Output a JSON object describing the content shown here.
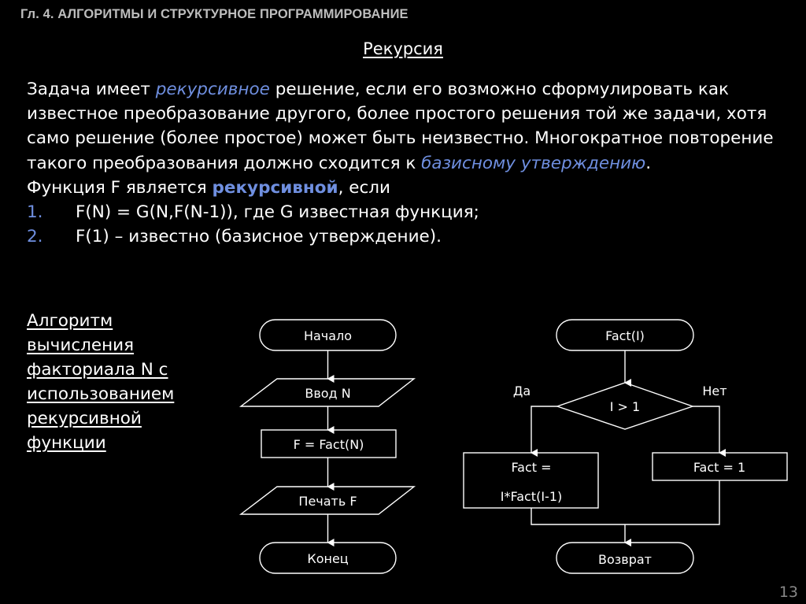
{
  "header": {
    "chapter": "Гл. 4. АЛГОРИТМЫ И СТРУКТУРНОЕ ПРОГРАММИРОВАНИЕ",
    "title": "Рекурсия"
  },
  "intro": {
    "s1": "Задача имеет ",
    "s1_em": "рекурсивное",
    "s2": " решение, если его возможно сформулировать как известное преобразование другого, более простого решения той же задачи, хотя само решение (более простое) может быть неизвестно. Многократное повторение такого преобразования должно сходится к ",
    "s2_em": "базисному утверждению",
    "s3": ".",
    "def_prefix": "Функция F является ",
    "def_strong": "рекурсивной",
    "def_suffix": ", если",
    "list": [
      {
        "num": "1.",
        "text": "F(N) = G(N,F(N-1)), где G известная функция;"
      },
      {
        "num": "2.",
        "text": "F(1) – известно (базисное утверждение)."
      }
    ]
  },
  "algo_caption": [
    "Алгоритм",
    "вычисления",
    "факториала N с",
    "использованием",
    "рекурсивной",
    "функции"
  ],
  "main_flow": {
    "start": "Начало",
    "input": "Ввод N",
    "process": "F = Fact(N)",
    "output": "Печать F",
    "end": "Конец"
  },
  "fact_flow": {
    "start": "Fact(I)",
    "condition": "I > 1",
    "yes_label": "Да",
    "no_label": "Нет",
    "yes_process_line1": "Fact =",
    "yes_process_line2": "I*Fact(I-1)",
    "no_process": "Fact = 1",
    "end": "Возврат"
  },
  "colors": {
    "accent": "#6f8fe0",
    "background": "#000000",
    "text": "#ffffff",
    "chapter": "#bdbdbd"
  },
  "page_number": "13"
}
